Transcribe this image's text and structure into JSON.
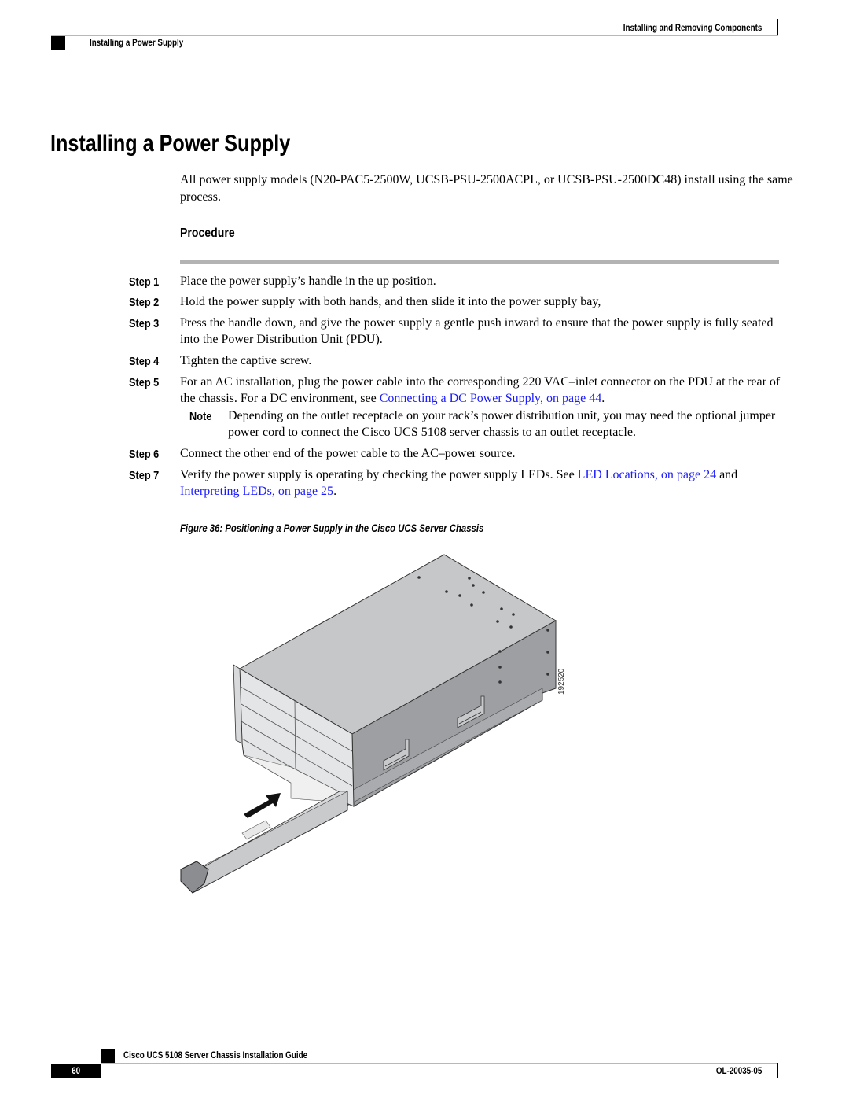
{
  "header": {
    "chapter": "Installing and Removing Components",
    "section": "Installing a Power Supply"
  },
  "title": "Installing a Power Supply",
  "intro": "All power supply models (N20-PAC5-2500W, UCSB-PSU-2500ACPL, or UCSB-PSU-2500DC48) install using the same process.",
  "procedure": {
    "heading": "Procedure",
    "steps": [
      {
        "label": "Step 1",
        "text": "Place the power supply’s handle in the up position."
      },
      {
        "label": "Step 2",
        "text": "Hold the power supply with both hands, and then slide it into the power supply bay,"
      },
      {
        "label": "Step 3",
        "text": "Press the handle down, and give the power supply a gentle push inward to ensure that the power supply is fully seated into the Power Distribution Unit (PDU)."
      },
      {
        "label": "Step 4",
        "text": "Tighten the captive screw."
      },
      {
        "label": "Step 5",
        "text": "For an AC installation, plug the power cable into the corresponding 220 VAC–inlet connector on the PDU at the rear of the chassis. For a DC environment, see ",
        "link": "Connecting a DC Power Supply,  on page 44",
        "after": ".",
        "note": {
          "label": "Note",
          "text": "Depending on the outlet receptacle on your rack’s power distribution unit, you may need the optional jumper power cord to connect the Cisco UCS 5108 server chassis to an outlet receptacle."
        }
      },
      {
        "label": "Step 6",
        "text": "Connect the other end of the power cable to the AC–power source."
      },
      {
        "label": "Step 7",
        "text": "Verify the power supply is operating by checking the power supply LEDs. See ",
        "link": "LED Locations,  on page 24",
        "middle": " and ",
        "link2": "Interpreting LEDs,  on page 25",
        "after": "."
      }
    ]
  },
  "figure": {
    "caption": "Figure 36: Positioning a Power Supply in the Cisco UCS Server Chassis",
    "id_label": "192520",
    "alt": "Power supply being slid into the bottom front bay of the Cisco UCS 5108 server chassis"
  },
  "footer": {
    "guide_title": "Cisco UCS 5108 Server Chassis Installation Guide",
    "page_number": "60",
    "doc_number": "OL-20035-05"
  },
  "colors": {
    "link": "#1a1aff",
    "rule": "#b3b3b3",
    "chassis_top": "#c6c7c9",
    "chassis_side": "#9d9fa2"
  }
}
